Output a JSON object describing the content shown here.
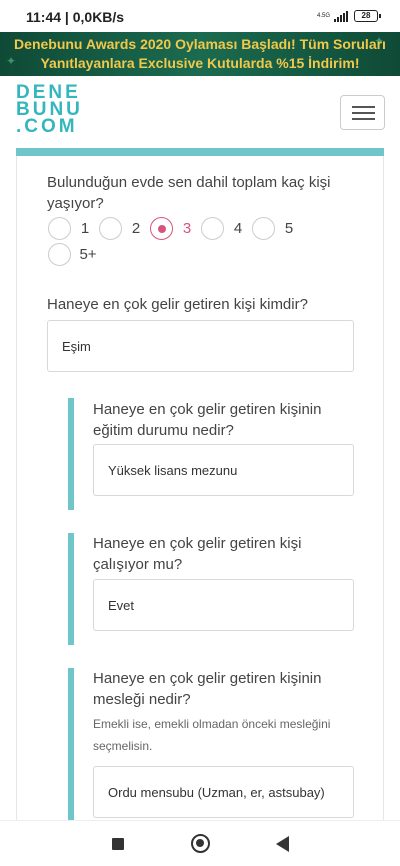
{
  "status_bar": {
    "time_speed": "11:44 | 0,0KB/s",
    "network": "4.5G",
    "battery": "28"
  },
  "banner": {
    "line1": "Denebunu Awards 2020 Oylaması Başladı! Tüm Soruları",
    "line2": "Yanıtlayanlara Exclusive Kutularda %15 İndirim!"
  },
  "header": {
    "logo_lines": [
      "DENE",
      "BUNU",
      ".COM"
    ]
  },
  "questions": {
    "household": {
      "text": "Bulunduğun evde sen dahil toplam kaç kişi yaşıyor?",
      "options": [
        "1",
        "2",
        "3",
        "4",
        "5",
        "5+"
      ],
      "selected": "3"
    },
    "earner": {
      "text": "Haneye en çok gelir getiren kişi kimdir?",
      "answer": "Eşim"
    },
    "education": {
      "text": "Haneye en çok gelir getiren kişinin eğitim durumu nedir?",
      "answer": "Yüksek lisans mezunu"
    },
    "working": {
      "text": "Haneye en çok gelir getiren kişi çalışıyor mu?",
      "answer": "Evet"
    },
    "profession": {
      "text": "Haneye en çok gelir getiren kişinin mesleği nedir?",
      "hint": "Emekli ise, emekli olmadan önceki mesleğini seçmelisin.",
      "answer": "Ordu mensubu (Uzman, er, astsubay)"
    }
  },
  "colors": {
    "accent_teal": "#6fc6c9",
    "selected_pink": "#d9547c",
    "banner_text": "#f2c84b",
    "banner_bg": "#1b6b50"
  }
}
